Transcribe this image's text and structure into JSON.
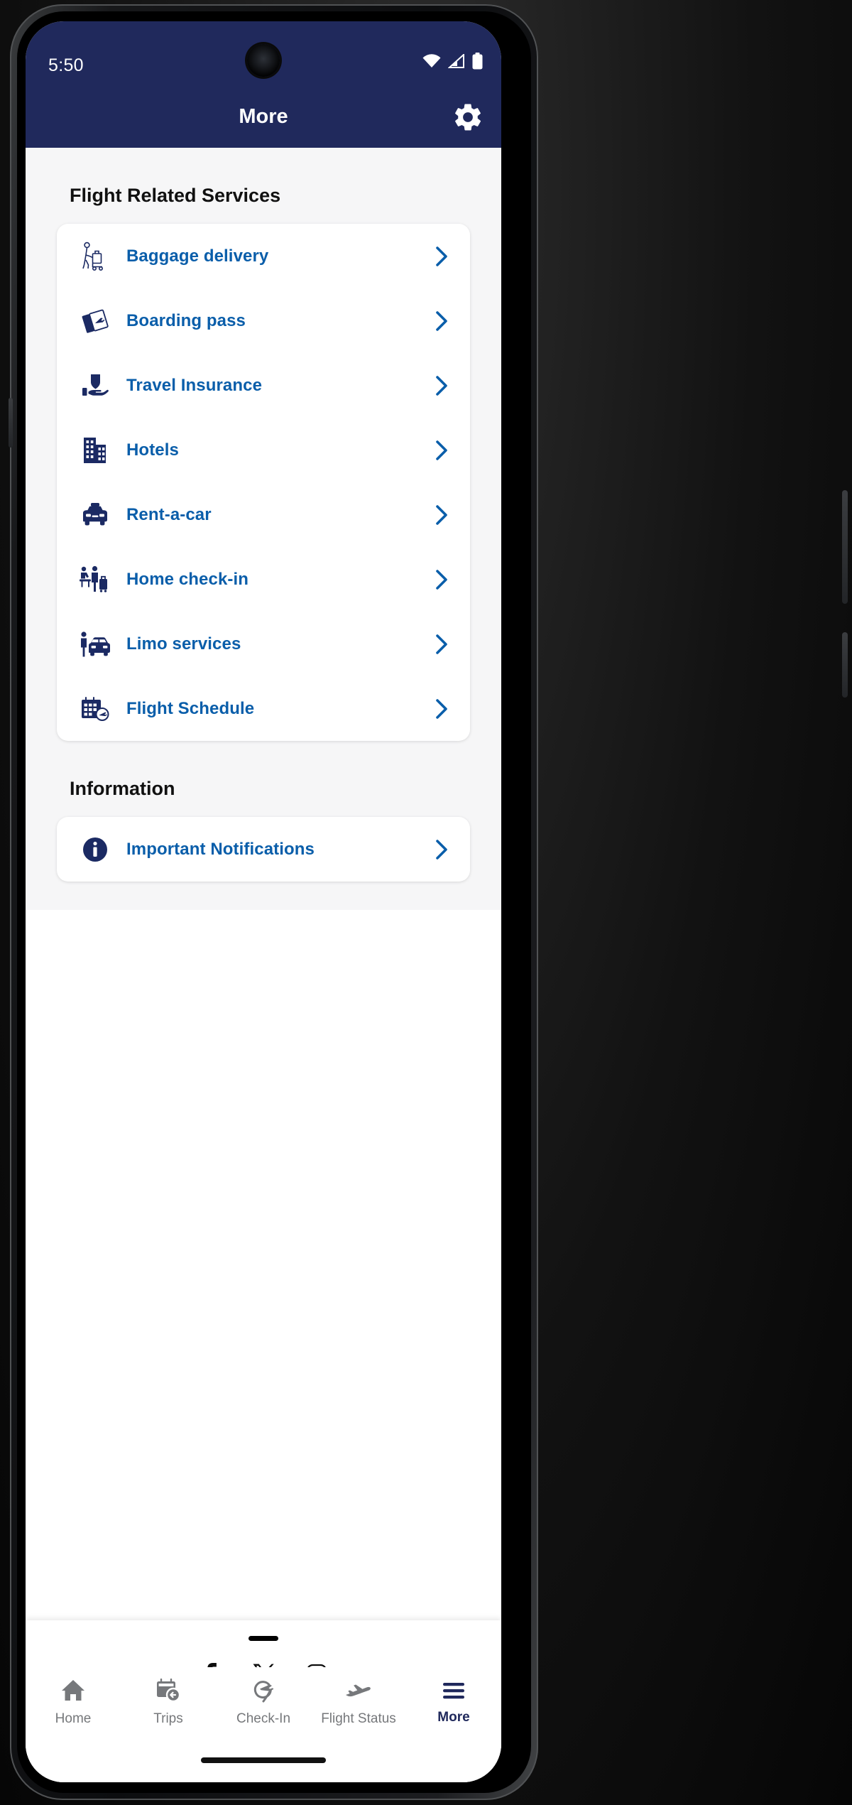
{
  "status_bar": {
    "time": "5:50",
    "icons": [
      "wifi-icon",
      "cellular-signal-icon",
      "battery-icon"
    ]
  },
  "header": {
    "title": "More",
    "settings_icon": "gear-icon"
  },
  "colors": {
    "header_navy": "#20295c",
    "link_blue": "#0a5eaa",
    "icon_navy": "#1b2a63",
    "page_bg": "#f6f6f7",
    "card_bg": "#ffffff",
    "nav_inactive": "#76787b"
  },
  "sections": [
    {
      "title": "Flight Related Services",
      "items": [
        {
          "label": "Baggage delivery",
          "icon": "porter-trolley-icon",
          "chevron": "chevron-right-icon"
        },
        {
          "label": "Boarding pass",
          "icon": "boarding-pass-icon",
          "chevron": "chevron-right-icon"
        },
        {
          "label": "Travel Insurance",
          "icon": "shield-hand-icon",
          "chevron": "chevron-right-icon"
        },
        {
          "label": "Hotels",
          "icon": "buildings-icon",
          "chevron": "chevron-right-icon"
        },
        {
          "label": "Rent-a-car",
          "icon": "taxi-car-icon",
          "chevron": "chevron-right-icon"
        },
        {
          "label": "Home check-in",
          "icon": "home-checkin-icon",
          "chevron": "chevron-right-icon"
        },
        {
          "label": "Limo services",
          "icon": "limo-person-car-icon",
          "chevron": "chevron-right-icon"
        },
        {
          "label": "Flight Schedule",
          "icon": "calendar-plane-icon",
          "chevron": "chevron-right-icon"
        }
      ]
    },
    {
      "title": "Information",
      "items": [
        {
          "label": "Important Notifications",
          "icon": "info-circle-icon",
          "chevron": "chevron-right-icon"
        }
      ]
    }
  ],
  "bottom_sheet": {
    "drag_handle": "drag-handle",
    "social": [
      {
        "name": "facebook-icon",
        "glyph": "f"
      },
      {
        "name": "x-twitter-icon",
        "glyph": "X"
      },
      {
        "name": "instagram-icon",
        "glyph": ""
      }
    ]
  },
  "bottom_nav": {
    "items": [
      {
        "label": "Home",
        "icon": "home-icon",
        "active": false
      },
      {
        "label": "Trips",
        "icon": "trips-calendar-icon",
        "active": false
      },
      {
        "label": "Check-In",
        "icon": "checkin-pin-icon",
        "active": false
      },
      {
        "label": "Flight Status",
        "icon": "airplane-icon",
        "active": false
      },
      {
        "label": "More",
        "icon": "hamburger-icon",
        "active": true
      }
    ]
  }
}
